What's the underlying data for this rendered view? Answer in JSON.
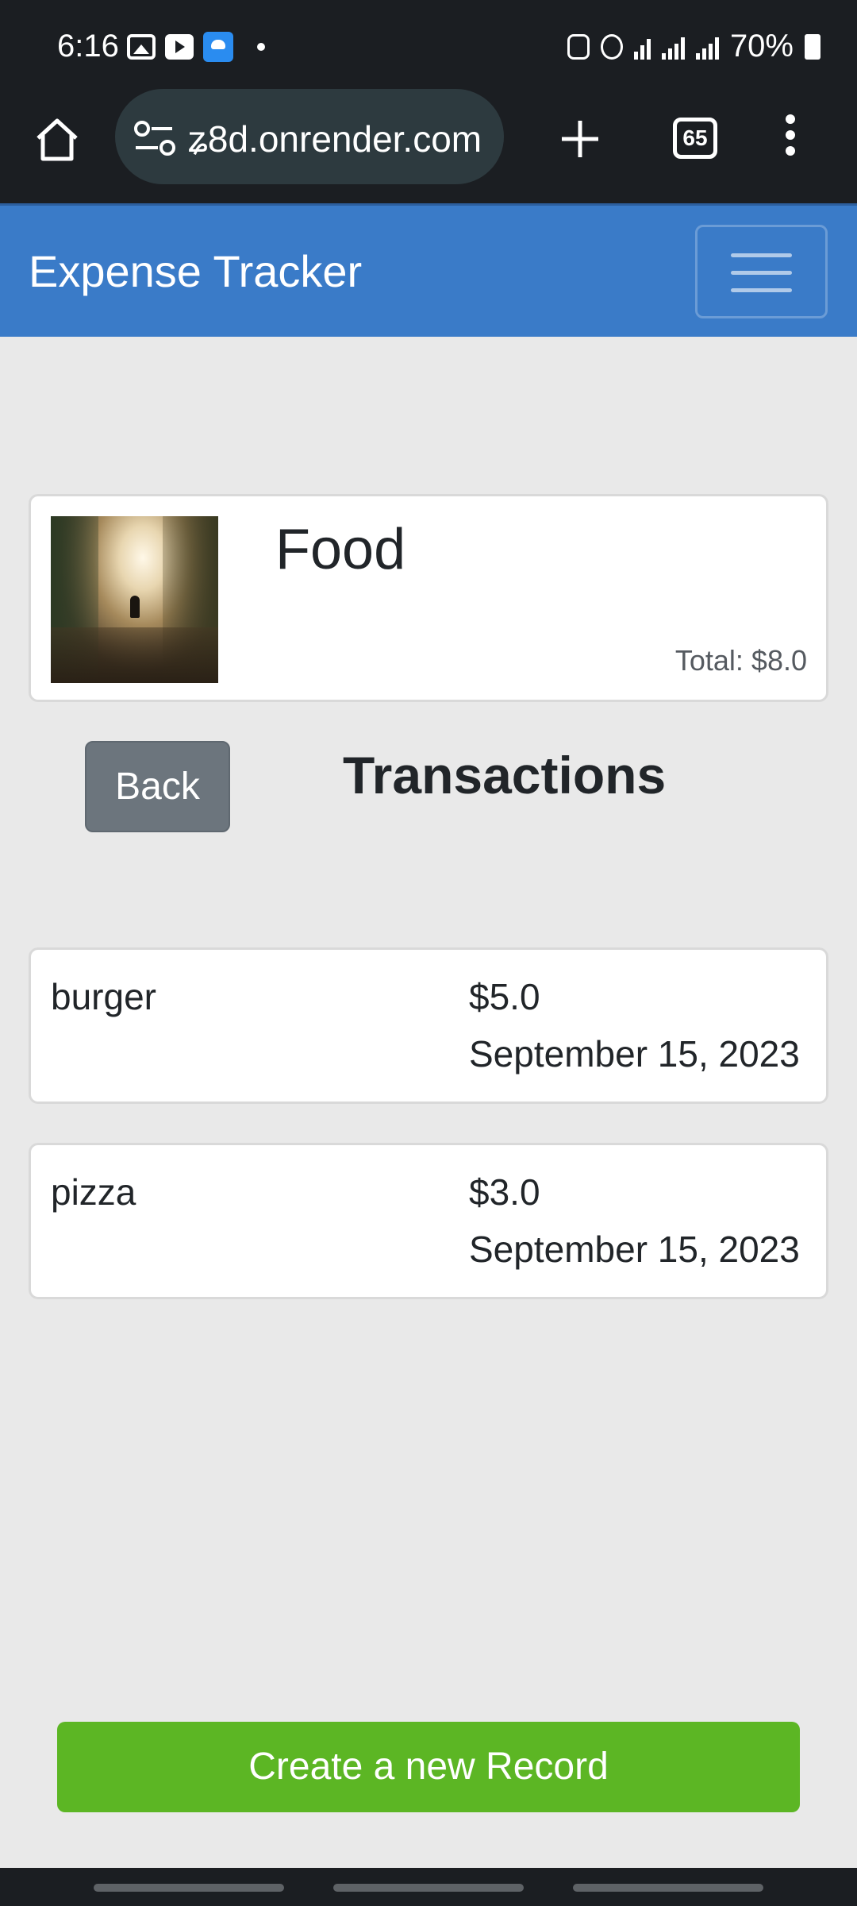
{
  "status_bar": {
    "time": "6:16",
    "battery": "70%"
  },
  "browser": {
    "url": "ʑ8d.onrender.com",
    "tab_count": "65"
  },
  "navbar": {
    "brand": "Expense Tracker"
  },
  "category": {
    "name": "Food",
    "total": "Total: $8.0"
  },
  "page": {
    "back_label": "Back",
    "section_title": "Transactions"
  },
  "transactions": [
    {
      "name": "burger",
      "amount": "$5.0",
      "date": "September 15, 2023"
    },
    {
      "name": "pizza",
      "amount": "$3.0",
      "date": "September 15, 2023"
    }
  ],
  "actions": {
    "create_label": "Create a new Record"
  },
  "colors": {
    "navbar": "#3a7bc8",
    "back_button": "#6c757d",
    "create_button": "#5cb624",
    "background": "#e9e9e9"
  }
}
